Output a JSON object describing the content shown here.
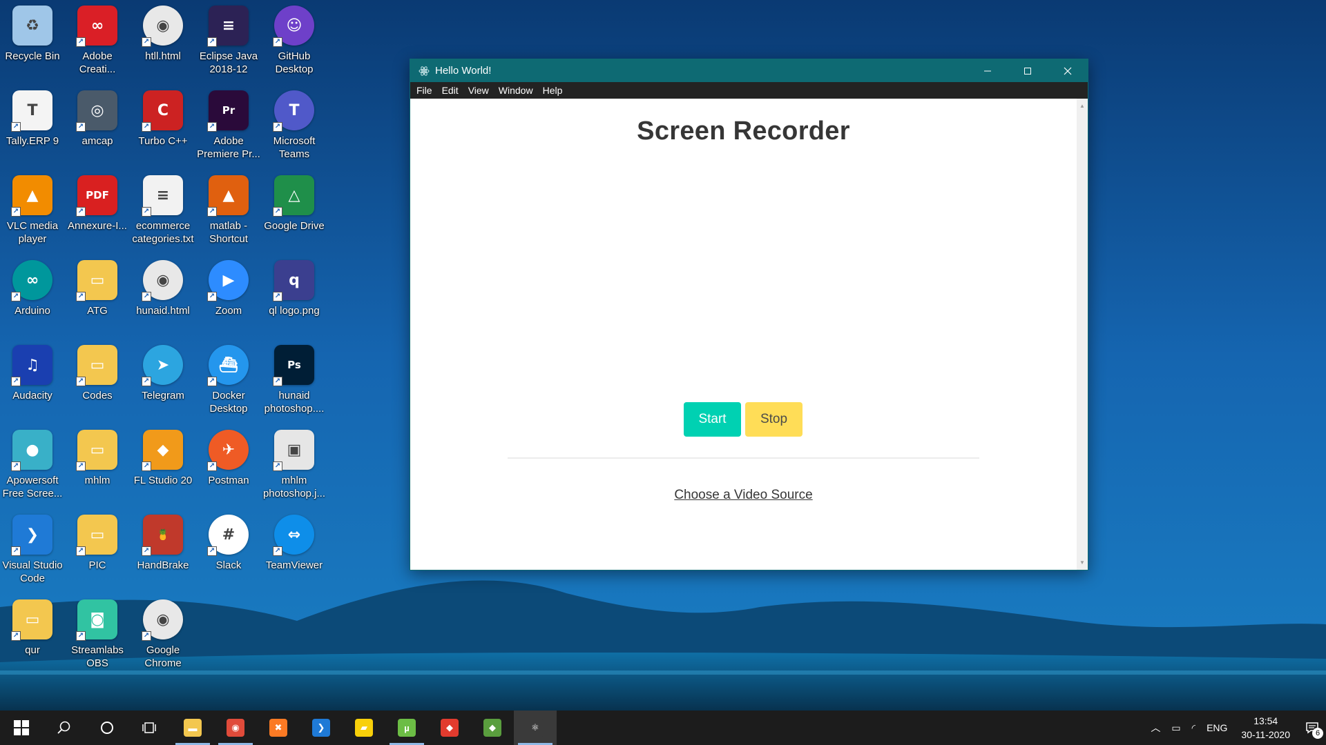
{
  "desktop": {
    "icons": [
      {
        "label": "Recycle Bin",
        "icon": "recycle-bin-icon",
        "color": "#9fc6e8",
        "glyph": "♻"
      },
      {
        "label": "Adobe Creati...",
        "icon": "adobe-creative-cloud-icon",
        "color": "#da1f26",
        "glyph": "∞"
      },
      {
        "label": "htll.html",
        "icon": "chrome-icon",
        "color": "#e8e8e8",
        "glyph": "◉"
      },
      {
        "label": "Eclipse Java 2018-12",
        "icon": "eclipse-icon",
        "color": "#2c2255",
        "glyph": "≡"
      },
      {
        "label": "GitHub Desktop",
        "icon": "github-desktop-icon",
        "color": "#6e40c9",
        "glyph": "☺"
      },
      {
        "label": "Tally.ERP 9",
        "icon": "tally-icon",
        "color": "#f4f4f4",
        "glyph": "T"
      },
      {
        "label": "amcap",
        "icon": "camera-icon",
        "color": "#4a5a6a",
        "glyph": "◎"
      },
      {
        "label": "Turbo C++",
        "icon": "turbo-cpp-icon",
        "color": "#cc2222",
        "glyph": "C"
      },
      {
        "label": "Adobe Premiere Pr...",
        "icon": "premiere-pro-icon",
        "color": "#2a0a3a",
        "glyph": "Pr"
      },
      {
        "label": "Microsoft Teams",
        "icon": "teams-icon",
        "color": "#5059c9",
        "glyph": "T"
      },
      {
        "label": "VLC media player",
        "icon": "vlc-icon",
        "color": "#f28c00",
        "glyph": "▲"
      },
      {
        "label": "Annexure-I...",
        "icon": "pdf-icon",
        "color": "#d92020",
        "glyph": "PDF"
      },
      {
        "label": "ecommerce categories.txt",
        "icon": "text-file-icon",
        "color": "#f2f2f2",
        "glyph": "≡"
      },
      {
        "label": "matlab - Shortcut",
        "icon": "matlab-icon",
        "color": "#e0600f",
        "glyph": "▲"
      },
      {
        "label": "Google Drive",
        "icon": "google-drive-icon",
        "color": "#1f8f4a",
        "glyph": "△"
      },
      {
        "label": "Arduino",
        "icon": "arduino-icon",
        "color": "#00979c",
        "glyph": "∞"
      },
      {
        "label": "ATG",
        "icon": "folder-icon",
        "color": "#f3c74f",
        "glyph": "▭"
      },
      {
        "label": "hunaid.html",
        "icon": "chrome-icon",
        "color": "#e8e8e8",
        "glyph": "◉"
      },
      {
        "label": "Zoom",
        "icon": "zoom-icon",
        "color": "#2d8cff",
        "glyph": "▶"
      },
      {
        "label": "ql logo.png",
        "icon": "image-file-icon",
        "color": "#3b3f8f",
        "glyph": "q"
      },
      {
        "label": "Audacity",
        "icon": "audacity-icon",
        "color": "#1a3fb0",
        "glyph": "♫"
      },
      {
        "label": "Codes",
        "icon": "folder-icon",
        "color": "#f3c74f",
        "glyph": "▭"
      },
      {
        "label": "Telegram",
        "icon": "telegram-icon",
        "color": "#2ca5e0",
        "glyph": "➤"
      },
      {
        "label": "Docker Desktop",
        "icon": "docker-icon",
        "color": "#2496ed",
        "glyph": "⛴"
      },
      {
        "label": "hunaid photoshop....",
        "icon": "photoshop-file-icon",
        "color": "#001e36",
        "glyph": "Ps"
      },
      {
        "label": "Apowersoft Free Scree...",
        "icon": "apowersoft-icon",
        "color": "#39b0c8",
        "glyph": "●"
      },
      {
        "label": "mhlm",
        "icon": "folder-icon",
        "color": "#f3c74f",
        "glyph": "▭"
      },
      {
        "label": "FL Studio 20",
        "icon": "fl-studio-icon",
        "color": "#f19a1a",
        "glyph": "◆"
      },
      {
        "label": "Postman",
        "icon": "postman-icon",
        "color": "#ef5b25",
        "glyph": "✈"
      },
      {
        "label": "mhlm photoshop.j...",
        "icon": "image-file-icon",
        "color": "#e6e6e6",
        "glyph": "▣"
      },
      {
        "label": "Visual Studio Code",
        "icon": "vscode-icon",
        "color": "#1f7ad6",
        "glyph": "❯"
      },
      {
        "label": "PIC",
        "icon": "folder-icon",
        "color": "#f3c74f",
        "glyph": "▭"
      },
      {
        "label": "HandBrake",
        "icon": "handbrake-icon",
        "color": "#c0392b",
        "glyph": "🍍"
      },
      {
        "label": "Slack",
        "icon": "slack-icon",
        "color": "#ffffff",
        "glyph": "#"
      },
      {
        "label": "TeamViewer",
        "icon": "teamviewer-icon",
        "color": "#0e8ee9",
        "glyph": "⇔"
      },
      {
        "label": "qur",
        "icon": "folder-icon",
        "color": "#f3c74f",
        "glyph": "▭"
      },
      {
        "label": "Streamlabs OBS",
        "icon": "streamlabs-icon",
        "color": "#31c3a2",
        "glyph": "◙"
      },
      {
        "label": "Google Chrome",
        "icon": "chrome-icon",
        "color": "#e8e8e8",
        "glyph": "◉"
      }
    ]
  },
  "window": {
    "title": "Hello World!",
    "menu": [
      "File",
      "Edit",
      "View",
      "Window",
      "Help"
    ],
    "heading": "Screen Recorder",
    "start_label": "Start",
    "stop_label": "Stop",
    "source_link": "Choose a Video Source",
    "colors": {
      "titlebar": "#0e6a73",
      "start": "#00d1b2",
      "stop": "#ffdd57"
    }
  },
  "taskbar": {
    "apps": [
      {
        "name": "file-explorer-icon",
        "color": "#f3c74f",
        "glyph": "▬"
      },
      {
        "name": "chrome-icon",
        "color": "#e04b3a",
        "glyph": "◉"
      },
      {
        "name": "xampp-icon",
        "color": "#fb7a24",
        "glyph": "✖"
      },
      {
        "name": "vscode-icon",
        "color": "#1f7ad6",
        "glyph": "❯"
      },
      {
        "name": "sticky-notes-icon",
        "color": "#f8d00a",
        "glyph": "▰"
      },
      {
        "name": "utorrent-icon",
        "color": "#6cbd45",
        "glyph": "µ"
      },
      {
        "name": "anydesk-icon",
        "color": "#e23b2e",
        "glyph": "◆"
      },
      {
        "name": "git-gui-icon",
        "color": "#5a9e3e",
        "glyph": "◆"
      },
      {
        "name": "electron-icon",
        "color": "#3a3a3a",
        "glyph": "⚛"
      }
    ],
    "tray": {
      "language": "ENG",
      "time": "13:54",
      "date": "30-11-2020",
      "notifications": "6"
    }
  }
}
